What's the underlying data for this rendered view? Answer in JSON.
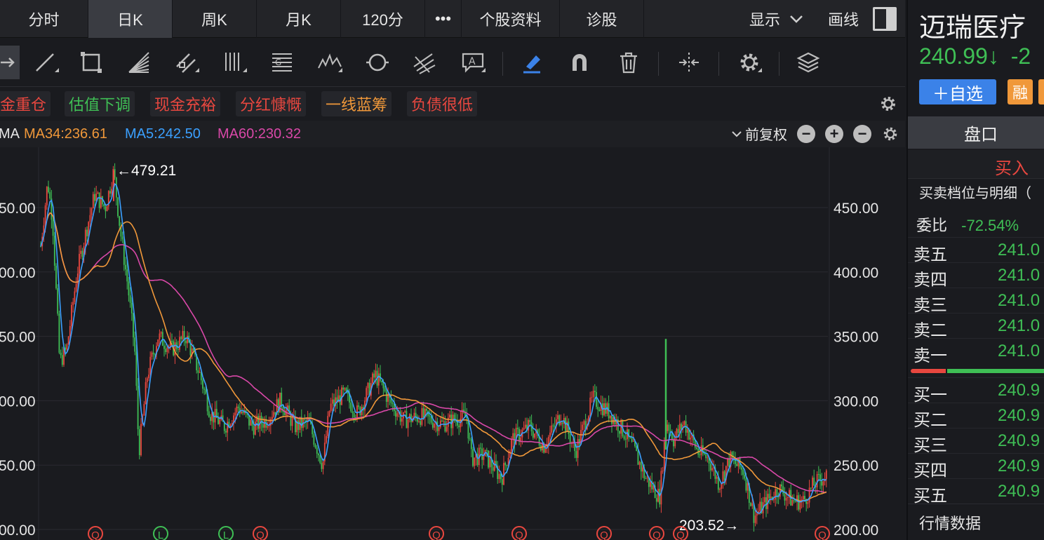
{
  "tabs": [
    {
      "label": "分时",
      "active": false
    },
    {
      "label": "日K",
      "active": true
    },
    {
      "label": "周K",
      "active": false
    },
    {
      "label": "月K",
      "active": false
    },
    {
      "label": "120分",
      "active": false
    },
    {
      "label": "•••",
      "active": false
    },
    {
      "label": "个股资料",
      "active": false
    },
    {
      "label": "诊股",
      "active": false
    }
  ],
  "header_right": {
    "show_label": "显示",
    "draw_label": "画线"
  },
  "toolbar_icons": [
    "arrow-icon",
    "line-icon",
    "rectangle-icon",
    "fan-icon",
    "parallel-channel-icon",
    "vertical-lines-icon",
    "gann-icon",
    "wave-icon",
    "cycle-icon",
    "fork-icon",
    "text-annotation-icon",
    "highlighter-icon",
    "magnet-icon",
    "trash-icon",
    "split-icon",
    "settings-icon",
    "layers-icon"
  ],
  "tags": [
    {
      "label": "金重仓",
      "color": "red"
    },
    {
      "label": "估值下调",
      "color": "green"
    },
    {
      "label": "现金充裕",
      "color": "red"
    },
    {
      "label": "分红慷慨",
      "color": "red"
    },
    {
      "label": "一线蓝筹",
      "color": "orange"
    },
    {
      "label": "负债很低",
      "color": "red"
    }
  ],
  "ma_legend": {
    "prefix": "MA",
    "ma34": "MA34:236.61",
    "ma5": "MA5:242.50",
    "ma60": "MA60:230.32",
    "adjust": "前复权"
  },
  "chart_data": {
    "type": "candlestick",
    "y_ticks_left": [
      ".00",
      "50.00",
      "00.00",
      "50.00",
      "00.00",
      "50.00",
      "00.00"
    ],
    "y_ticks_right": [
      "450.00",
      "400.00",
      "350.00",
      "300.00",
      "250.00",
      "200.00"
    ],
    "ylim": [
      200,
      480
    ],
    "high_label": "←479.21",
    "low_label": "203.52→",
    "high": 479.21,
    "low": 203.52,
    "markers": [
      "Q",
      "L",
      "L",
      "Q",
      "Q",
      "Q",
      "Q",
      "Q",
      "Q",
      "Q"
    ],
    "colors": {
      "up": "#e8473f",
      "down": "#3fbf55",
      "ma5": "#3ba0ff",
      "ma34": "#f0983a",
      "ma60": "#d948a8",
      "grid": "#2a2b30"
    }
  },
  "quote": {
    "name": "迈瑞医疗",
    "price": "240.99↓",
    "change": "-2",
    "add_watch": "＋自选",
    "margin": "融",
    "panel_tab": "盘口",
    "buy_label": "买入",
    "detail_label": "买卖档位与明细（",
    "weibi_label": "委比",
    "weibi_value": "-72.54%",
    "asks": [
      {
        "label": "卖五",
        "price": "241.0"
      },
      {
        "label": "卖四",
        "price": "241.0"
      },
      {
        "label": "卖三",
        "price": "241.0"
      },
      {
        "label": "卖二",
        "price": "241.0"
      },
      {
        "label": "卖一",
        "price": "241.0"
      }
    ],
    "bids": [
      {
        "label": "买一",
        "price": "240.9"
      },
      {
        "label": "买二",
        "price": "240.9"
      },
      {
        "label": "买三",
        "price": "240.9"
      },
      {
        "label": "买四",
        "price": "240.9"
      },
      {
        "label": "买五",
        "price": "240.9"
      }
    ],
    "market_data_label": "行情数据"
  }
}
